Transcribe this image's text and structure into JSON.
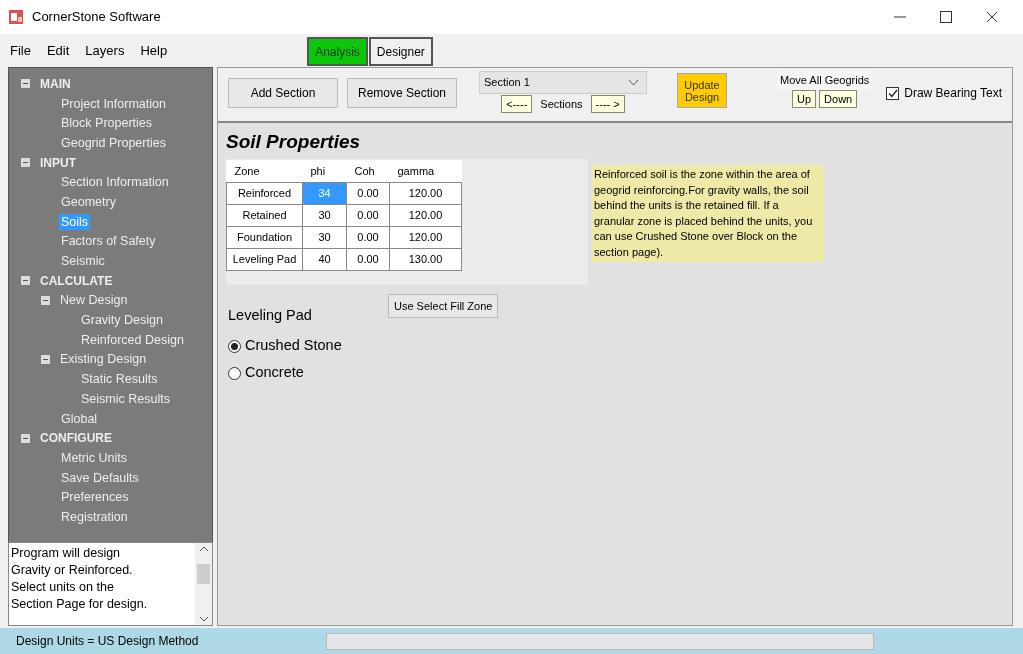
{
  "window": {
    "title": "CornerStone Software"
  },
  "menu": [
    "File",
    "Edit",
    "Layers",
    "Help"
  ],
  "modes": [
    {
      "label": "Analysis",
      "selected": true
    },
    {
      "label": "Designer",
      "selected": false
    }
  ],
  "tree": [
    {
      "label": "MAIN",
      "expanded": true,
      "selected": false,
      "children": [
        {
          "label": "Project Information",
          "selected": false
        },
        {
          "label": "Block Properties",
          "selected": false
        },
        {
          "label": "Geogrid Properties",
          "selected": false
        }
      ]
    },
    {
      "label": "INPUT",
      "expanded": true,
      "selected": false,
      "children": [
        {
          "label": "Section Information",
          "selected": false
        },
        {
          "label": "Geometry",
          "selected": false
        },
        {
          "label": "Soils",
          "selected": true
        },
        {
          "label": "Factors of Safety",
          "selected": false
        },
        {
          "label": "Seismic",
          "selected": false
        }
      ]
    },
    {
      "label": "CALCULATE",
      "expanded": true,
      "selected": false,
      "children": [
        {
          "label": "New Design",
          "expanded": true,
          "selected": false,
          "children": [
            {
              "label": "Gravity Design",
              "selected": false
            },
            {
              "label": "Reinforced Design",
              "selected": false
            }
          ]
        },
        {
          "label": "Existing Design",
          "expanded": true,
          "selected": false,
          "children": [
            {
              "label": "Static Results",
              "selected": false
            },
            {
              "label": "Seismic Results",
              "selected": false
            }
          ]
        },
        {
          "label": "Global",
          "selected": false
        }
      ]
    },
    {
      "label": "CONFIGURE",
      "expanded": true,
      "selected": false,
      "children": [
        {
          "label": "Metric Units",
          "selected": false
        },
        {
          "label": "Save Defaults",
          "selected": false
        },
        {
          "label": "Preferences",
          "selected": false
        },
        {
          "label": "Registration",
          "selected": false
        }
      ]
    }
  ],
  "notes": [
    "Program will design",
    "Gravity or Reinforced.",
    "Select units on the",
    "Section Page for design."
  ],
  "toolbar": {
    "add_button": "Add Section",
    "remove_button": "Remove Section",
    "section_select": "Section 1",
    "prev_button": "<----",
    "sections_label": "Sections",
    "next_button": "---- >",
    "update_button": "Update Design",
    "move_label": "Move All Geogrids",
    "up_button": "Up",
    "down_button": "Down",
    "draw_bearing": {
      "label": "Draw Bearing Text",
      "checked": true
    }
  },
  "page_title": "Soil Properties",
  "table": {
    "columns": [
      "Zone",
      "phi",
      "Coh",
      "gamma"
    ],
    "rows": [
      {
        "cells": [
          {
            "text": "Reinforced",
            "selected": false
          },
          {
            "text": "34",
            "selected": true
          },
          {
            "text": "0.00",
            "selected": false
          },
          {
            "text": "120.00",
            "selected": false
          }
        ]
      },
      {
        "cells": [
          {
            "text": "Retained",
            "selected": false
          },
          {
            "text": "30",
            "selected": false
          },
          {
            "text": "0.00",
            "selected": false
          },
          {
            "text": "120.00",
            "selected": false
          }
        ]
      },
      {
        "cells": [
          {
            "text": "Foundation",
            "selected": false
          },
          {
            "text": "30",
            "selected": false
          },
          {
            "text": "0.00",
            "selected": false
          },
          {
            "text": "120.00",
            "selected": false
          }
        ]
      },
      {
        "cells": [
          {
            "text": "Leveling Pad",
            "selected": false
          },
          {
            "text": "40",
            "selected": false
          },
          {
            "text": "0.00",
            "selected": false
          },
          {
            "text": "130.00",
            "selected": false
          }
        ]
      }
    ]
  },
  "info": "Reinforced soil is the zone within the area of geogrid reinforcing.For gravity walls, the soil behind the units is the retained fill. If a granular zone is placed behind the units, you can use Crushed Stone over Block on the section page).",
  "leveling_pad": {
    "title": "Leveling Pad",
    "options": [
      {
        "label": "Crushed Stone",
        "selected": true
      },
      {
        "label": "Concrete",
        "selected": false
      }
    ]
  },
  "fill_button": "Use Select Fill Zone",
  "status_bar": {
    "text": "Design Units = US  Design Method",
    "progress": {
      "level": 0
    }
  }
}
